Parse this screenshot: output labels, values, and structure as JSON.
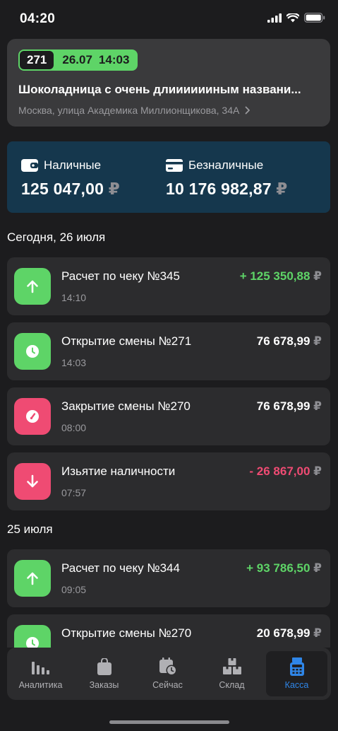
{
  "status_bar": {
    "time": "04:20"
  },
  "shift": {
    "number": "271",
    "date": "26.07",
    "time": "14:03",
    "title": "Шоколадница с очень длииииииным названи...",
    "address": "Москва, улица Академика Миллионщикова, 34А"
  },
  "balance": {
    "cash_label": "Наличные",
    "cash_value": "125 047,00",
    "card_label": "Безналичные",
    "card_value": "10 176 982,87",
    "currency": "₽"
  },
  "groups": [
    {
      "title": "Сегодня, 26 июля"
    },
    {
      "title": "25 июля"
    }
  ],
  "operations": [
    {
      "title": "Расчет по чеку №345",
      "time": "14:10",
      "amount": "+ 125 350,88",
      "currency": "₽",
      "icon": "arrow-up-icon",
      "color": "#5ed467",
      "amount_color": "#5ed467"
    },
    {
      "title": "Открытие смены №271",
      "time": "14:03",
      "amount": "76 678,99",
      "currency": "₽",
      "icon": "clock-icon",
      "color": "#5ed467",
      "amount_color": "#ffffff"
    },
    {
      "title": "Закрытие смены №270",
      "time": "08:00",
      "amount": "76 678,99",
      "currency": "₽",
      "icon": "gauge-icon",
      "color": "#ef4b73",
      "amount_color": "#ffffff"
    },
    {
      "title": "Изьятие наличности",
      "time": "07:57",
      "amount": "- 26 867,00",
      "currency": "₽",
      "icon": "arrow-down-icon",
      "color": "#ef4b73",
      "amount_color": "#ef4b73"
    },
    {
      "title": "Расчет по чеку №344",
      "time": "09:05",
      "amount": "+ 93 786,50",
      "currency": "₽",
      "icon": "arrow-up-icon",
      "color": "#5ed467",
      "amount_color": "#5ed467"
    },
    {
      "title": "Открытие смены №270",
      "time": "",
      "amount": "20 678,99",
      "currency": "₽",
      "icon": "clock-icon",
      "color": "#5ed467",
      "amount_color": "#ffffff"
    }
  ],
  "tabbar": {
    "active": "Касса",
    "items": [
      {
        "label": "Аналитика",
        "icon": "bar-chart-icon"
      },
      {
        "label": "Заказы",
        "icon": "bag-icon"
      },
      {
        "label": "Сейчас",
        "icon": "calendar-clock-icon"
      },
      {
        "label": "Склад",
        "icon": "boxes-icon"
      },
      {
        "label": "Касса",
        "icon": "cash-register-icon"
      }
    ]
  },
  "colors": {
    "accent": "#2f86e8",
    "positive": "#5ed467",
    "negative": "#ef4b73",
    "balance_bg": "#15374d"
  }
}
